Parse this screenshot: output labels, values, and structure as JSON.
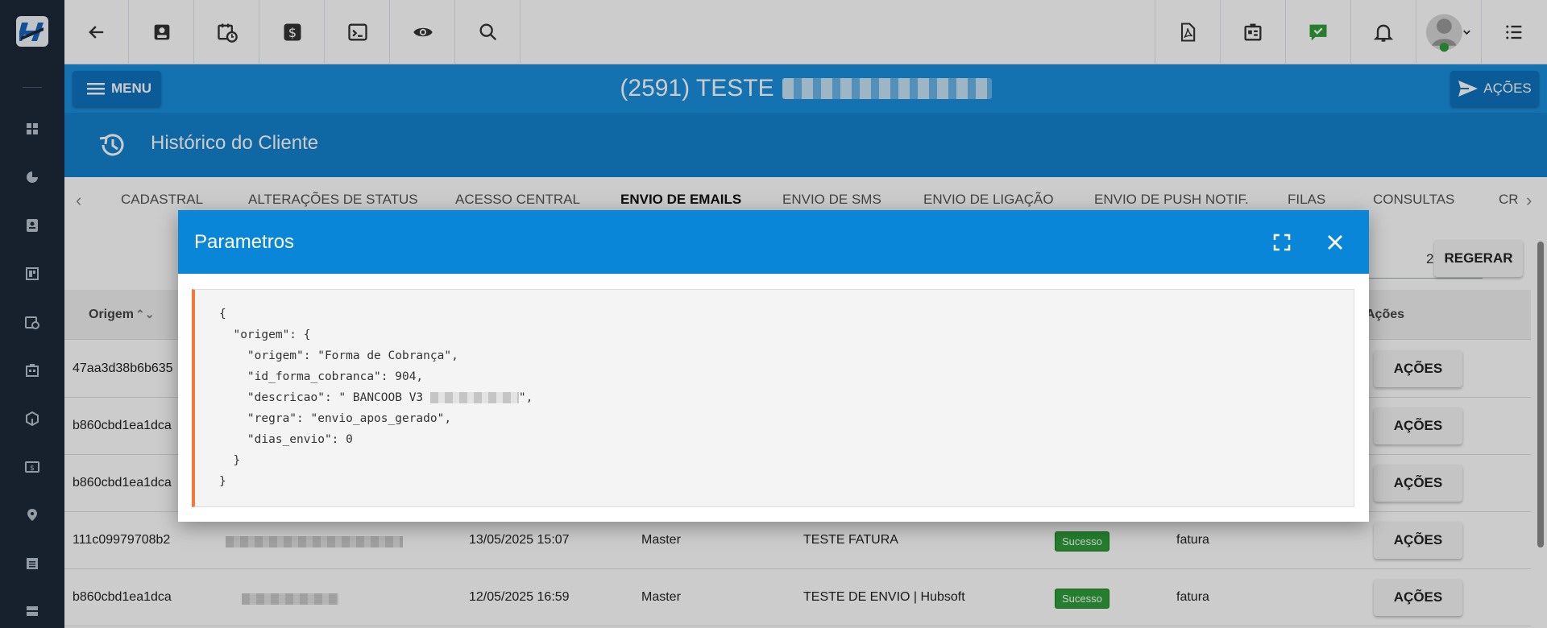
{
  "header": {
    "menu_label": "MENU",
    "client_title": "(2591) TESTE",
    "acoes_label": "AÇÕES",
    "section_title": "Histórico do Cliente"
  },
  "tabs": [
    {
      "label": "CADASTRAL"
    },
    {
      "label": "ALTERAÇÕES DE STATUS"
    },
    {
      "label": "ACESSO CENTRAL"
    },
    {
      "label": "ENVIO DE EMAILS",
      "active": true
    },
    {
      "label": "ENVIO DE SMS"
    },
    {
      "label": "ENVIO DE LIGAÇÃO"
    },
    {
      "label": "ENVIO DE PUSH NOTIF."
    },
    {
      "label": "FILAS"
    },
    {
      "label": "CONSULTAS"
    },
    {
      "label": "CR"
    }
  ],
  "toolbar": {
    "date_value": "2025",
    "regerar_label": "REGERAR"
  },
  "table": {
    "headers": {
      "origem": "Origem",
      "acoes": "Ações"
    },
    "action_label": "AÇÕES",
    "rows": [
      {
        "id": "47aa3d38b6b635",
        "date": "",
        "user": "",
        "subject": "",
        "status": "",
        "type": ""
      },
      {
        "id": "b860cbd1ea1dca",
        "date": "",
        "user": "",
        "subject": "",
        "status": "",
        "type": ""
      },
      {
        "id": "b860cbd1ea1dca",
        "date": "",
        "user": "",
        "subject": "",
        "status": "",
        "type": ""
      },
      {
        "id": "111c09979708b2",
        "date": "13/05/2025 15:07",
        "user": "Master",
        "subject": "TESTE FATURA",
        "status": "Sucesso",
        "type": "fatura"
      },
      {
        "id": "b860cbd1ea1dca",
        "date": "12/05/2025 16:59",
        "user": "Master",
        "subject": "TESTE DE ENVIO | Hubsoft",
        "status": "Sucesso",
        "type": "fatura"
      }
    ]
  },
  "modal": {
    "title": "Parametros",
    "lines": [
      "{",
      "  \"origem\": {",
      "    \"origem\": \"Forma de Cobrança\",",
      "    \"id_forma_cobranca\": 904,",
      "    \"descricao\": \" BANCOOB V3",
      "    \"regra\": \"envio_apos_gerado\",",
      "    \"dias_envio\": 0",
      "  }",
      "}"
    ],
    "descricao_suffix": "\","
  },
  "colors": {
    "primary": "#1a8fdd",
    "modal_header": "#0a86d8",
    "success": "#2e9e3a",
    "code_accent": "#f07a3a",
    "rail": "#1d2a3a"
  },
  "icons": {
    "rail": [
      "dashboard-icon",
      "pie-chart-icon",
      "contact-card-icon",
      "board-icon",
      "calendar-clock-icon",
      "building-icon",
      "package-icon",
      "money-icon",
      "location-icon",
      "list-icon",
      "server-icon"
    ],
    "top_left": [
      "back-arrow-icon",
      "contact-icon",
      "calendar-clock-icon",
      "dollar-icon",
      "terminal-icon",
      "eye-icon",
      "search-icon"
    ],
    "top_right": [
      "pdf-icon",
      "id-badge-icon",
      "check-chat-icon",
      "bell-icon",
      "avatar",
      "list-menu-icon"
    ]
  }
}
